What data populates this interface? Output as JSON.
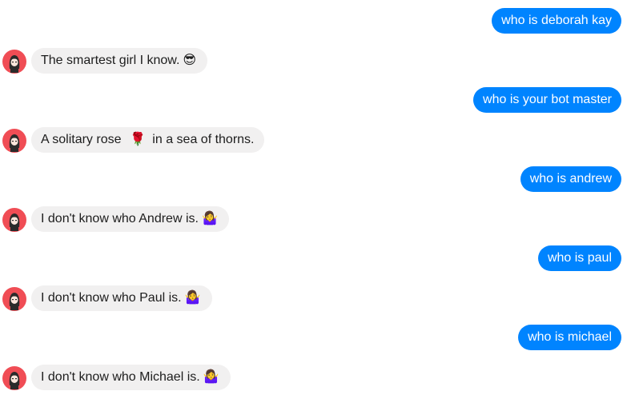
{
  "messages": [
    {
      "side": "out",
      "text": "who is deborah kay"
    },
    {
      "side": "in",
      "text": "The smartest girl I know.",
      "emoji": "😎",
      "emoji_name": "sunglasses-emoji-icon"
    },
    {
      "side": "out",
      "text": "who is your bot master"
    },
    {
      "side": "in",
      "text_before": "A solitary rose",
      "emoji": "🌹",
      "emoji_name": "rose-emoji-icon",
      "text_after": "in a sea of thorns."
    },
    {
      "side": "out",
      "text": "who is andrew"
    },
    {
      "side": "in",
      "text": "I don't know who Andrew is.",
      "emoji": "🤷‍♀️",
      "emoji_name": "shrug-emoji-icon"
    },
    {
      "side": "out",
      "text": "who is paul"
    },
    {
      "side": "in",
      "text": "I don't know who Paul is.",
      "emoji": "🤷‍♀️",
      "emoji_name": "shrug-emoji-icon"
    },
    {
      "side": "out",
      "text": "who is michael"
    },
    {
      "side": "in",
      "text": "I don't know who Michael is.",
      "emoji": "🤷‍♀️",
      "emoji_name": "shrug-emoji-icon"
    }
  ],
  "colors": {
    "outgoing_bubble": "#0084ff",
    "incoming_bubble": "#f1f0f0",
    "avatar_background": "#f04d55"
  }
}
